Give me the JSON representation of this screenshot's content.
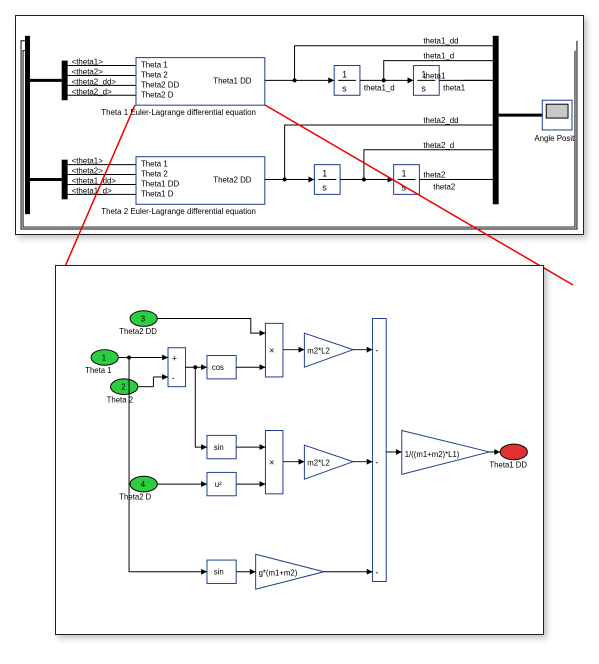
{
  "top": {
    "bus1": {
      "signals": [
        "<theta1>",
        "<theta2>",
        "<theta2_dd>",
        "<theta2_d>"
      ]
    },
    "bus2": {
      "signals": [
        "<theta1>",
        "<theta2>",
        "<theta1_dd>",
        "<theta1_d>"
      ]
    },
    "block1": {
      "inputs": [
        "Theta 1",
        "Theta 2",
        "Theta2  DD",
        "Theta2  D"
      ],
      "output": "Theta1 DD",
      "caption": "Theta 1 Euler-Lagrange differential equation"
    },
    "block2": {
      "inputs": [
        "Theta 1",
        "Theta 2",
        "Theta1  DD",
        "Theta1  D"
      ],
      "output": "Theta2 DD",
      "caption": "Theta 2 Euler-Lagrange differential equation"
    },
    "int": "1\ns",
    "sig_labels": [
      "theta1_dd",
      "theta1_d",
      "theta1",
      "theta2_dd",
      "theta2_d",
      "theta2"
    ],
    "scope": "Angle Posit",
    "int_out1": "theta1_d",
    "int_out2": "theta1",
    "int_out3": "theta2"
  },
  "bottom": {
    "ports": {
      "p1": {
        "num": "1",
        "name": "Theta 1"
      },
      "p2": {
        "num": "2",
        "name": "Theta 2"
      },
      "p3": {
        "num": "3",
        "name": "Theta2  DD"
      },
      "p4": {
        "num": "4",
        "name": "Theta2  D"
      },
      "out": {
        "name": "Theta1 DD"
      }
    },
    "blocks": {
      "cos": "cos",
      "sin1": "sin",
      "sin2": "sin",
      "sq": "u²",
      "mul": "×",
      "gain1": "m2*L2",
      "gain2": "m2*L2",
      "gain3": "g*(m1+m2)",
      "gain4": "1/((m1+m2)*L1)"
    },
    "sum1": {
      "a": "+",
      "b": "-"
    },
    "sum2": {
      "a": "-",
      "b": "-",
      "c": "-"
    }
  },
  "chart_data": {
    "type": "diagram",
    "description": "Simulink block diagram of a double-pendulum system. Top panel: two Euler-Lagrange subsystems (Theta1 and Theta2) each feed two chained 1/s integrators; six bus signals (theta1_dd, theta1_d, theta1, theta2_dd, theta2_d, theta2) go to a Mux then a Scope labelled 'Angle Posit'. Bottom panel: expanded Theta1 subsystem — inputs Theta1, Theta2, Theta2 DD, Theta2 D; computes cos(Theta1−Theta2)·Theta2DD·m2·L2, sin(Theta1−Theta2)·(Theta2D)²·m2·L2, and sin(Theta1)·g·(m1+m2); negated sum is scaled by 1/((m1+m2)·L1) to produce Theta1 DD."
  }
}
